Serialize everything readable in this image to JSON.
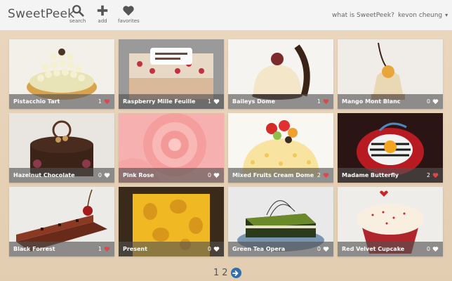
{
  "app": {
    "brand": "SweetPeek"
  },
  "nav": {
    "search_label": "search",
    "add_label": "add",
    "favorites_label": "favorites",
    "about_label": "what is SweetPeek?",
    "user_label": "kevon cheung"
  },
  "items": [
    {
      "name": "Pistacchio Tart",
      "likes": "1",
      "liked": true
    },
    {
      "name": "Raspberry Mille Feuille",
      "likes": "1",
      "liked": true
    },
    {
      "name": "Baileys Dome",
      "likes": "1",
      "liked": true
    },
    {
      "name": "Mango Mont Blanc",
      "likes": "0",
      "liked": false
    },
    {
      "name": "Hazelnut Chocolate",
      "likes": "0",
      "liked": false
    },
    {
      "name": "Pink Rose",
      "likes": "0",
      "liked": false
    },
    {
      "name": "Mixed Fruits Cream Dome",
      "likes": "2",
      "liked": true
    },
    {
      "name": "Madame Butterfly",
      "likes": "2",
      "liked": true
    },
    {
      "name": "Black Forrest",
      "likes": "1",
      "liked": true
    },
    {
      "name": "Present",
      "likes": "0",
      "liked": false
    },
    {
      "name": "Green Tea Opera",
      "likes": "0",
      "liked": false
    },
    {
      "name": "Red Velvet Cupcake",
      "likes": "0",
      "liked": false
    }
  ],
  "pagination": {
    "page1": "1",
    "page2": "2"
  },
  "colors": {
    "liked_heart": "#e0474c",
    "unliked_heart": "#ffffff",
    "accent": "#2f6fb0"
  }
}
